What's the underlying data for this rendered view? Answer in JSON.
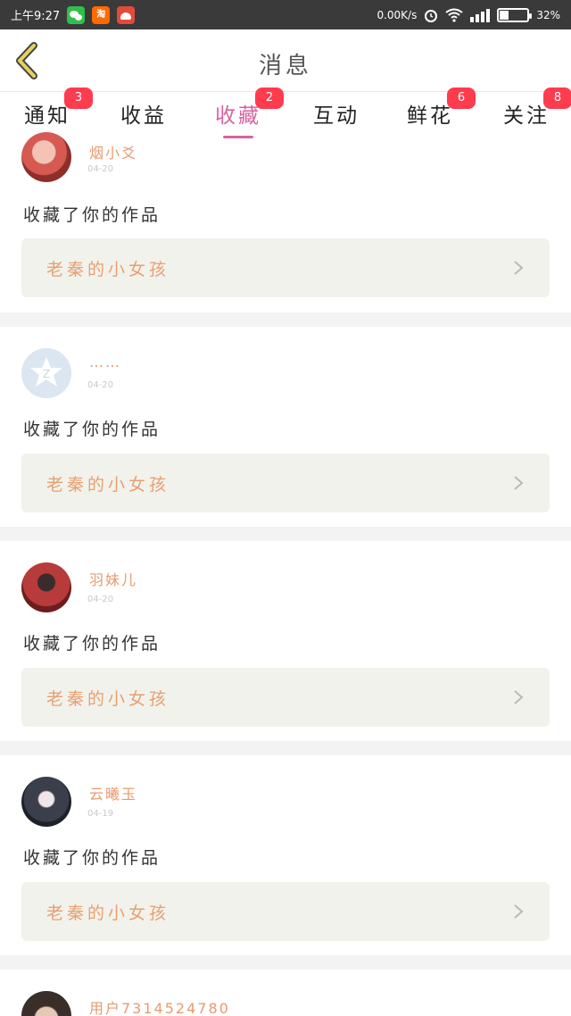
{
  "status_bar": {
    "time": "上午9:27",
    "taobao_label": "淘",
    "net_speed": "0.00K/s",
    "battery_percent": "32%",
    "battery_level": 0.32
  },
  "header": {
    "title": "消息"
  },
  "tabs": [
    {
      "label": "通知",
      "badge": "3",
      "active": false
    },
    {
      "label": "收益",
      "badge": "",
      "active": false
    },
    {
      "label": "收藏",
      "badge": "2",
      "active": true
    },
    {
      "label": "互动",
      "badge": "",
      "active": false
    },
    {
      "label": "鲜花",
      "badge": "6",
      "active": false
    },
    {
      "label": "关注",
      "badge": "8",
      "active": false
    }
  ],
  "items": [
    {
      "user": "烟小爻",
      "date": "04-20",
      "action": "收藏了你的作品",
      "work": "老秦的小女孩",
      "avatar": "photo-avatar"
    },
    {
      "user": "……",
      "date": "04-20",
      "action": "收藏了你的作品",
      "work": "老秦的小女孩",
      "avatar": "qq-default-avatar"
    },
    {
      "user": "羽妹儿",
      "date": "04-20",
      "action": "收藏了你的作品",
      "work": "老秦的小女孩",
      "avatar": "photo-avatar"
    },
    {
      "user": "云曦玉",
      "date": "04-19",
      "action": "收藏了你的作品",
      "work": "老秦的小女孩",
      "avatar": "photo-avatar"
    },
    {
      "user": "用户7314524780",
      "date": "",
      "action": "",
      "work": "",
      "avatar": "photo-avatar"
    }
  ],
  "colors": {
    "accent": "#d8629e",
    "username": "#e89a6f",
    "badge": "#ff3b4e",
    "work_box": "#f2f2ec"
  }
}
